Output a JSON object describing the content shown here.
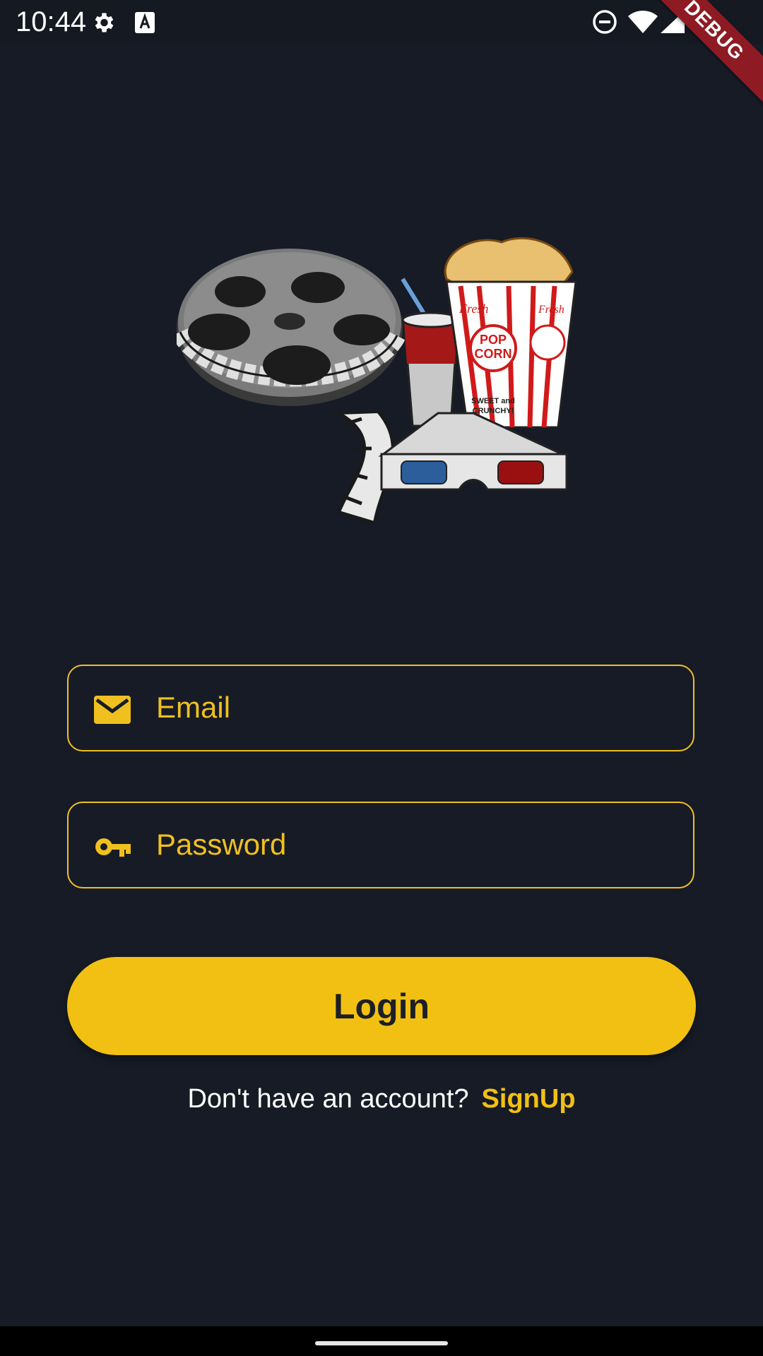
{
  "status_bar": {
    "time": "10:44",
    "debug_label": "DEBUG"
  },
  "hero": {
    "popcorn_fresh_left": "Fresh",
    "popcorn_fresh_right": "Fresh",
    "popcorn_logo_top": "POP",
    "popcorn_logo_bottom": "CORN",
    "popcorn_tagline_top": "SWEET and",
    "popcorn_tagline_bottom": "CRUNCHY!"
  },
  "form": {
    "email_placeholder": "Email",
    "password_placeholder": "Password",
    "login_label": "Login"
  },
  "signup": {
    "prompt": "Don't have an account?",
    "link": "SignUp"
  },
  "colors": {
    "background": "#161b26",
    "accent": "#f2c012",
    "text": "#ffffff"
  }
}
